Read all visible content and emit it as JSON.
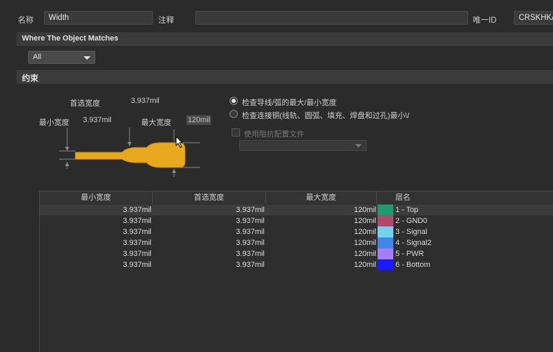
{
  "header": {
    "name_label": "名称",
    "name_value": "Width",
    "comment_label": "注释",
    "comment_value": "",
    "uid_label": "唯一ID",
    "uid_value": "CRSKHKAN"
  },
  "where_section": {
    "title": "Where The Object Matches",
    "scope_value": "All"
  },
  "constraints_section": {
    "title": "约束",
    "preferred_label": "首选宽度",
    "preferred_value": "3.937mil",
    "min_label": "最小宽度",
    "min_value": "3.937mil",
    "max_label": "最大宽度",
    "max_value": "120mil",
    "radio_trace": "检查导线/弧的最大/最小宽度",
    "radio_copper": "检查连接铜(线轨、圆弧、填充、焊盘和过孔)最小\\/",
    "impedance_label": "使用阻抗配置文件",
    "impedance_value": ""
  },
  "table": {
    "headers": [
      "最小宽度",
      "首选宽度",
      "最大宽度",
      "层名"
    ],
    "rows": [
      {
        "min": "3.937mil",
        "pref": "3.937mil",
        "max": "120mil",
        "color": "#1f9a6e",
        "layer": "1 - Top"
      },
      {
        "min": "3.937mil",
        "pref": "3.937mil",
        "max": "120mil",
        "color": "#b0476e",
        "layer": "2 - GND0"
      },
      {
        "min": "3.937mil",
        "pref": "3.937mil",
        "max": "120mil",
        "color": "#6fd3f0",
        "layer": "3 - Signal"
      },
      {
        "min": "3.937mil",
        "pref": "3.937mil",
        "max": "120mil",
        "color": "#3f86e6",
        "layer": "4 - Signal2"
      },
      {
        "min": "3.937mil",
        "pref": "3.937mil",
        "max": "120mil",
        "color": "#a57df5",
        "layer": "5 - PWR"
      },
      {
        "min": "3.937mil",
        "pref": "3.937mil",
        "max": "120mil",
        "color": "#1a1aff",
        "layer": "6 - Bottom"
      }
    ]
  }
}
